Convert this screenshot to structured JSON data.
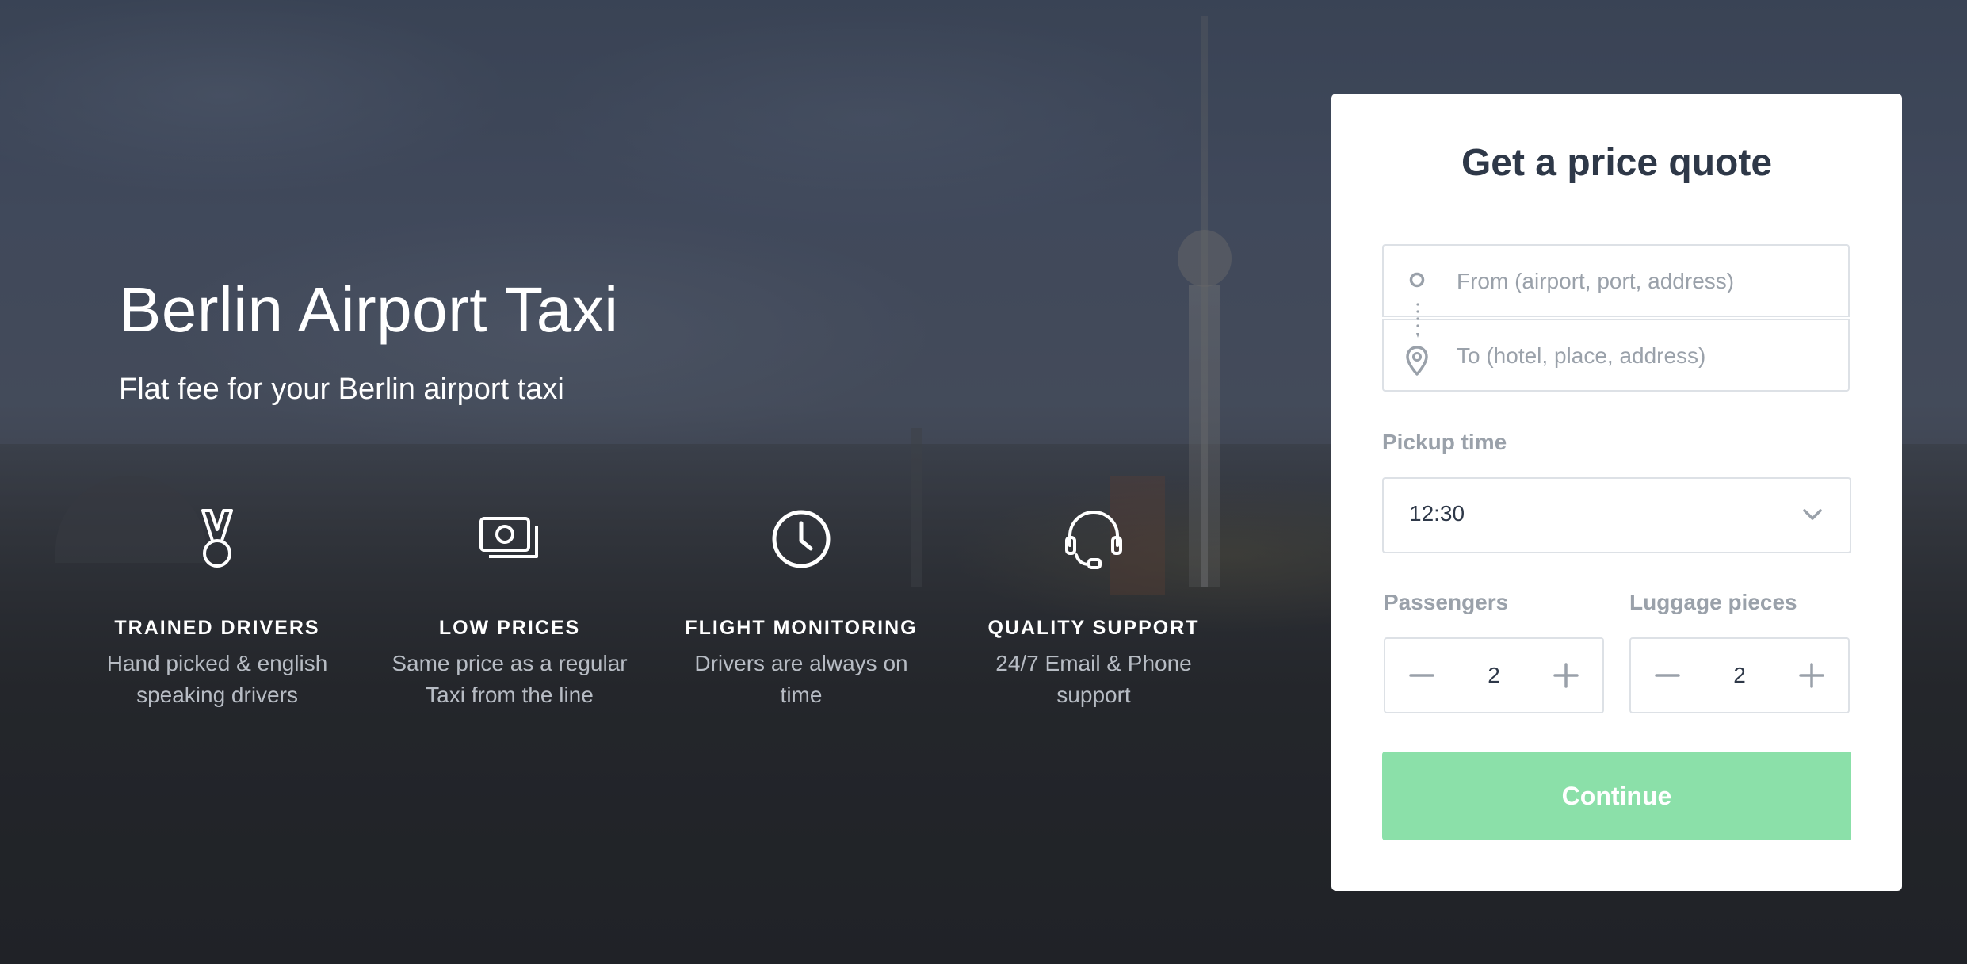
{
  "hero": {
    "title": "Berlin Airport Taxi",
    "subtitle": "Flat fee for your Berlin airport taxi"
  },
  "features": [
    {
      "icon": "medal-icon",
      "title": "TRAINED DRIVERS",
      "description": "Hand picked & english speaking drivers"
    },
    {
      "icon": "money-icon",
      "title": "LOW PRICES",
      "description": "Same price as a regular Taxi from the line"
    },
    {
      "icon": "clock-icon",
      "title": "FLIGHT MONITORING",
      "description": "Drivers are always on time"
    },
    {
      "icon": "headset-icon",
      "title": "QUALITY SUPPORT",
      "description": "24/7 Email & Phone support"
    }
  ],
  "quote_form": {
    "title": "Get a price quote",
    "from_placeholder": "From (airport, port, address)",
    "to_placeholder": "To (hotel, place, address)",
    "pickup_label": "Pickup time",
    "pickup_value": "12:30",
    "passengers_label": "Passengers",
    "passengers_value": "2",
    "luggage_label": "Luggage pieces",
    "luggage_value": "2",
    "continue_label": "Continue"
  },
  "colors": {
    "continue_button": "#8be0a9",
    "card_title": "#2e3848",
    "label": "#9aa1aa",
    "field_border": "#dde1e6"
  }
}
